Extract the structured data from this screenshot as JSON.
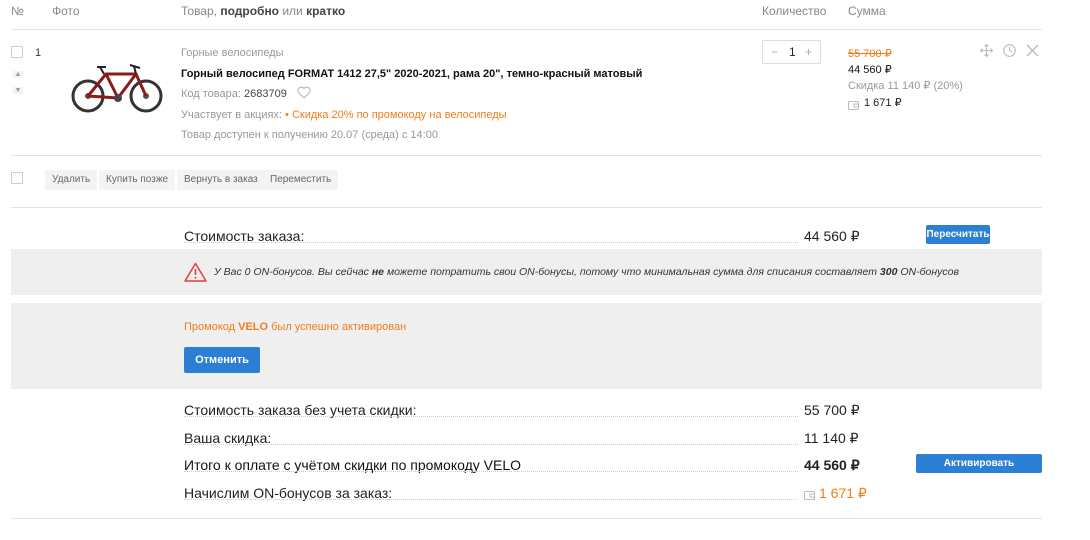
{
  "header": {
    "num": "№",
    "photo": "Фото",
    "product_prefix": "Товар, ",
    "product_detailed": "подробно",
    "product_or": " или ",
    "product_brief": "кратко",
    "quantity": "Количество",
    "sum": "Сумма"
  },
  "item": {
    "index": "1",
    "category": "Горные велосипеды",
    "title": "Горный велосипед FORMAT 1412 27,5\" 2020-2021, рама 20\", темно-красный матовый",
    "code_label": "Код товара: ",
    "code": "2683709",
    "promo_label": "Участвует в акциях: ",
    "promo_text": "• Скидка 20% по промокоду на велосипеды",
    "availability": "Товар доступен к получению 20.07 (среда) с 14:00",
    "quantity": "1",
    "minus": "−",
    "plus": "+",
    "old_price": "55 700 ₽",
    "price": "44 560 ₽",
    "discount": "Скидка 11 140 ₽ (20%)",
    "bonus": "1 671 ₽"
  },
  "actions": {
    "delete": "Удалить",
    "buy_later": "Купить позже",
    "return": "Вернуть в заказ",
    "move": "Переместить"
  },
  "order": {
    "cost_label": "Стоимость заказа:",
    "cost_value": "44 560 ₽",
    "recalc_button": "Пересчитать"
  },
  "warning": {
    "part1": "У Вас 0 ON-бонусов. Вы сейчас ",
    "part2": "не",
    "part3": " можете потратить свои ON-бонусы, потому что минимальная сумма для списания составляет ",
    "part4": "300",
    "part5": " ON-бонусов"
  },
  "promo": {
    "prefix": "Промокод ",
    "code": "VELO",
    "suffix": " был успешно активирован",
    "cancel_button": "Отменить"
  },
  "summary": {
    "no_discount_label": "Стоимость заказа без учета скидки:",
    "no_discount_value": "55 700 ₽",
    "discount_label": "Ваша скидка:",
    "discount_value": "11 140 ₽",
    "total_label": "Итого к оплате с учётом скидки по промокоду VELO",
    "total_value": "44 560 ₽",
    "bonus_label": "Начислим ON-бонусов за заказ:",
    "bonus_value": "1 671 ₽",
    "cert_button": "Активировать сертификат"
  },
  "colors": {
    "accent": "#2b7fd4",
    "orange": "#f07d1a",
    "green": "#8dc63f",
    "warning_red": "#e0413a"
  }
}
